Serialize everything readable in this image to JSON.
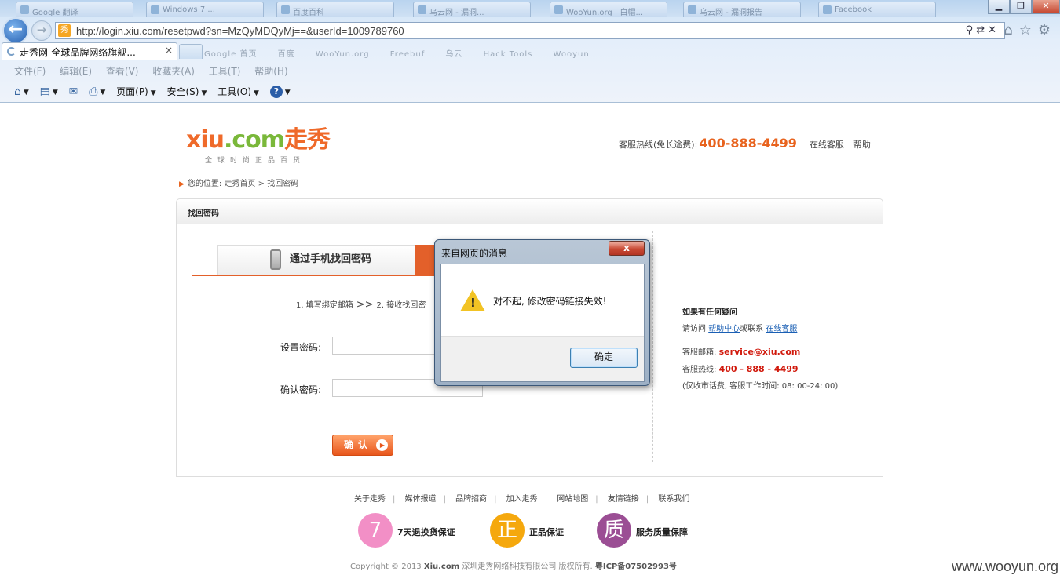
{
  "browser": {
    "bg_tabs": [
      "Google 翻译",
      "Windows 7 ...",
      "百度百科",
      "乌云网 - 漏洞...",
      "WooYun.org | 白帽...",
      "乌云网 - 漏洞报告",
      "Facebook"
    ],
    "url": "http://login.xiu.com/resetpwd?sn=MzQyMDQyMj==&userId=1009789760",
    "active_tab": "走秀网-全球品牌网络旗舰...",
    "tab_close": "×",
    "favorites": [
      "Google 首页",
      "百度",
      "WooYun.org",
      "Freebuf",
      "乌云",
      "Hack Tools",
      "Wooyun"
    ],
    "menu": [
      "文件(F)",
      "编辑(E)",
      "查看(V)",
      "收藏夹(A)",
      "工具(T)",
      "帮助(H)"
    ],
    "commands": {
      "page": "页面(P)",
      "safety": "安全(S)",
      "tools": "工具(O)"
    }
  },
  "site": {
    "logo_text_a": "xiu",
    "logo_text_b": ".com",
    "logo_text_c": "走秀",
    "logo_sub": "全球时尚正品百货",
    "hotline_label": "客服热线(免长途费):",
    "hotline_number": "400-888-4499",
    "online_service": "在线客服",
    "help_link": "帮助",
    "breadcrumb": "您的位置: 走秀首页 > 找回密码"
  },
  "panel": {
    "title": "找回密码",
    "tab_phone": "通过手机找回密码",
    "steps_a": "1. 填写绑定邮箱",
    "steps_arrow": ">>",
    "steps_b": "2. 接收找回密",
    "label_password": "设置密码:",
    "label_confirm": "确认密码:",
    "password_value": "",
    "confirm_value": "",
    "confirm_button": "确认"
  },
  "help": {
    "title": "如果有任何疑问",
    "visit_prefix": "请访问",
    "help_center": "帮助中心",
    "or_contact": "或联系",
    "online_service": "在线客服",
    "email_label": "客服邮箱:",
    "email": "service@xiu.com",
    "phone_label": "客服热线:",
    "phone": "400 - 888 - 4499",
    "note": "(仅收市话费, 客服工作时间: 08: 00-24: 00)"
  },
  "footer": {
    "links": [
      "关于走秀",
      "媒体报道",
      "品牌招商",
      "加入走秀",
      "网站地图",
      "友情链接",
      "联系我们"
    ],
    "badges": [
      {
        "glyph": "7",
        "text": "7天退换货保证",
        "color": "#f28fc6"
      },
      {
        "glyph": "正",
        "text": "正品保证",
        "color": "#f5a80d"
      },
      {
        "glyph": "质",
        "text": "服务质量保障",
        "color": "#9b4e94"
      }
    ],
    "copyright_prefix": "Copyright © 2013",
    "copyright_brand": "Xiu.com",
    "copyright_company": "深圳走秀网络科技有限公司 版权所有.",
    "icp": "粤ICP备07502993号",
    "watermark": "www.wooyun.org"
  },
  "dialog": {
    "title": "来自网页的消息",
    "close": "x",
    "message": "对不起, 修改密码链接失效!",
    "ok": "确定"
  }
}
